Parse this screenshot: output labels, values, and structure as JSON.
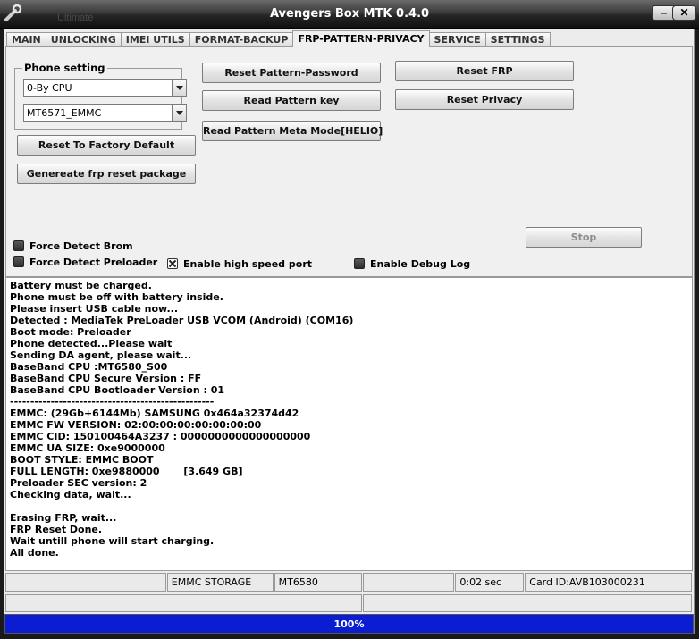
{
  "window": {
    "title": "Avengers Box MTK 0.4.0",
    "ghost_label": "Ultimate",
    "minimize_label": "–",
    "close_label": "✕"
  },
  "tabs": [
    {
      "label": "MAIN"
    },
    {
      "label": "UNLOCKING"
    },
    {
      "label": "IMEI UTILS"
    },
    {
      "label": "FORMAT-BACKUP"
    },
    {
      "label": "FRP-PATTERN-PRIVACY",
      "active": true
    },
    {
      "label": "SERVICE"
    },
    {
      "label": "SETTINGS"
    }
  ],
  "phone_setting": {
    "legend": "Phone setting",
    "cpu_mode": "0-By CPU",
    "model": "MT6571_EMMC"
  },
  "buttons": {
    "reset_factory": "Reset To Factory Default",
    "gen_frp_package": "Genereate frp reset package",
    "reset_pattern_password": "Reset Pattern-Password",
    "read_pattern_key": "Read Pattern key",
    "read_pattern_meta": "Read Pattern Meta Mode[HELIO]",
    "reset_frp": "Reset FRP",
    "reset_privacy": "Reset Privacy",
    "stop": "Stop"
  },
  "options": {
    "force_detect_brom": {
      "label": "Force Detect Brom",
      "checked": false
    },
    "force_detect_preloader": {
      "label": "Force Detect Preloader",
      "checked": false
    },
    "high_speed_port": {
      "label": "Enable high speed port",
      "checked": true
    },
    "debug_log": {
      "label": "Enable Debug Log",
      "checked": false
    }
  },
  "log": "Battery must be charged.\nPhone must be off with battery inside.\nPlease insert USB cable now...\nDetected : MediaTek PreLoader USB VCOM (Android) (COM16)\nBoot mode: Preloader\nPhone detected...Please wait\nSending DA agent, please wait...\nBaseBand CPU :MT6580_S00\nBaseBand CPU Secure Version : FF\nBaseBand CPU Bootloader Version : 01\n--------------------------------------------------\nEMMC: (29Gb+6144Mb) SAMSUNG 0x464a32374d42\nEMMC FW VERSION: 02:00:00:00:00:00:00:00\nEMMC CID: 150100464A3237 : 0000000000000000000\nEMMC UA SIZE: 0xe9000000\nBOOT STYLE: EMMC BOOT\nFULL LENGTH: 0xe9880000       [3.649 GB]\nPreloader SEC version: 2\nChecking data, wait...\n\nErasing FRP, wait...\nFRP Reset Done.\nWait untill phone will start charging.\nAll done.",
  "status": {
    "cell1": "",
    "storage": "EMMC STORAGE",
    "chip": "MT6580",
    "cell4": "",
    "time": "0:02 sec",
    "card_id": "Card ID:AVB103000231"
  },
  "progress": {
    "value": 1.0,
    "label": "100%"
  },
  "colors": {
    "progress_fill": "#0a1dd0",
    "titlebar": "#262626"
  }
}
